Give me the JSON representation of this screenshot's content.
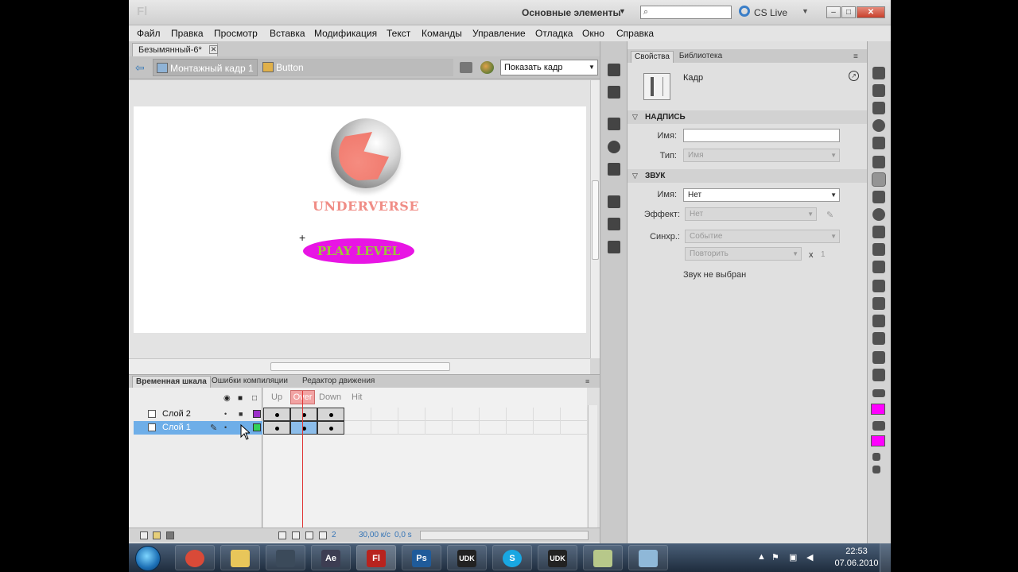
{
  "app": {
    "logo": "Fl",
    "workspace": "Основные элементы",
    "search_placeholder": "",
    "cs_live": "CS Live"
  },
  "menu": [
    "Файл",
    "Правка",
    "Просмотр",
    "Вставка",
    "Модификация",
    "Текст",
    "Команды",
    "Управление",
    "Отладка",
    "Окно",
    "Справка"
  ],
  "document": {
    "tab": "Безымянный-6*",
    "breadcrumb_scene": "Монтажный кадр 1",
    "breadcrumb_symbol": "Button",
    "zoom": "Показать кадр"
  },
  "stage": {
    "brand": "UNDERVERSE",
    "button_label": "PLAY LEVEL",
    "button_color": "#e815e4",
    "brand_color": "#f08d86"
  },
  "properties": {
    "tab_properties": "Свойства",
    "tab_library": "Библиотека",
    "type": "Кадр",
    "section_label": "НАДПИСЬ",
    "name_label": "Имя:",
    "name_value": "",
    "type_label": "Тип:",
    "type_value": "Имя",
    "section_sound": "ЗВУК",
    "sound_name_label": "Имя:",
    "sound_name_value": "Нет",
    "effect_label": "Эффект:",
    "effect_value": "Нет",
    "sync_label": "Синхр.:",
    "sync_value": "Событие",
    "repeat_value": "Повторить",
    "repeat_x": "x",
    "repeat_count": "1",
    "no_sound": "Звук не выбран"
  },
  "timeline": {
    "tabs": [
      "Временная шкала",
      "Ошибки компиляции",
      "Редактор движения"
    ],
    "frame_headers": [
      "Up",
      "Over",
      "Down",
      "Hit"
    ],
    "layers": [
      {
        "name": "Слой 2",
        "color": "#9b2fc9",
        "selected": false
      },
      {
        "name": "Слой 1",
        "color": "#33d15a",
        "selected": true
      }
    ],
    "frame_num": "2",
    "fps": "30,00 к/с",
    "elapsed": "0,0 s"
  },
  "taskbar": {
    "apps": [
      {
        "name": "chrome",
        "label": "",
        "color": "#d94a38"
      },
      {
        "name": "explorer",
        "label": "",
        "color": "#e8c65a"
      },
      {
        "name": "media",
        "label": "",
        "color": "#3b4a5a"
      },
      {
        "name": "after-effects",
        "label": "Ae",
        "color": "#3d3d52"
      },
      {
        "name": "flash",
        "label": "Fl",
        "color": "#b8231e"
      },
      {
        "name": "photoshop",
        "label": "Ps",
        "color": "#1f5b9a"
      },
      {
        "name": "udk-1",
        "label": "UDK",
        "color": "#222222"
      },
      {
        "name": "skype",
        "label": "S",
        "color": "#19a7e2"
      },
      {
        "name": "udk-2",
        "label": "UDK",
        "color": "#222222"
      },
      {
        "name": "notes",
        "label": "",
        "color": "#b7c88a"
      },
      {
        "name": "app",
        "label": "",
        "color": "#8fb8d8"
      }
    ],
    "time": "22:53",
    "date": "07.06.2010"
  }
}
